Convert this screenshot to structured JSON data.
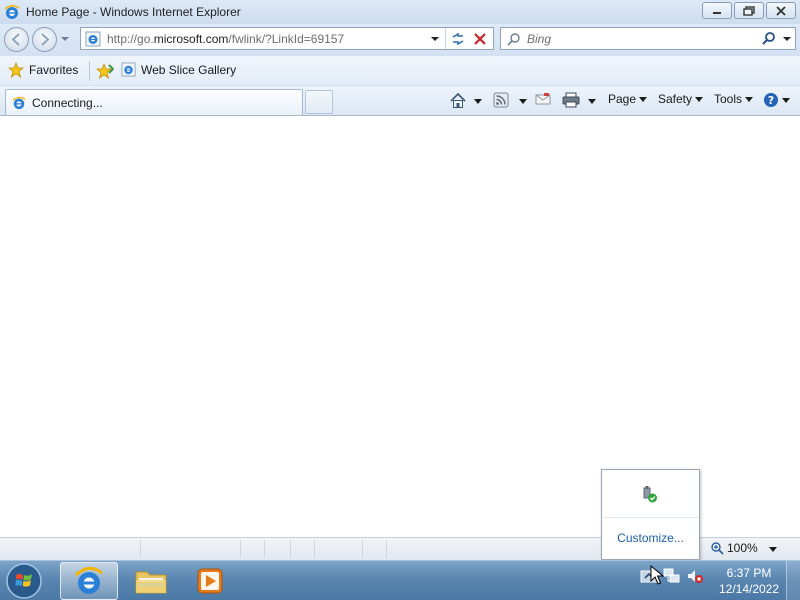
{
  "window": {
    "title": "Home Page - Windows Internet Explorer",
    "minimize_icon": "minimize-icon",
    "restore_icon": "restore-icon",
    "close_icon": "close-icon"
  },
  "nav": {
    "address_prefix": "http://go.",
    "address_domain": "microsoft.com",
    "address_suffix": "/fwlink/?LinkId=69157",
    "search_placeholder": "Bing"
  },
  "favorites": {
    "favorites_label": "Favorites",
    "web_slice_label": "Web Slice Gallery"
  },
  "tab": {
    "label": "Connecting..."
  },
  "commands": {
    "page": "Page",
    "safety": "Safety",
    "tools": "Tools"
  },
  "status": {
    "zoom": "100%"
  },
  "tray_popup": {
    "customize": "Customize..."
  },
  "taskbar": {
    "time": "6:37 PM",
    "date": "12/14/2022"
  },
  "colors": {
    "accent": "#1e5fa8",
    "taskbar": "#5a86b1"
  }
}
